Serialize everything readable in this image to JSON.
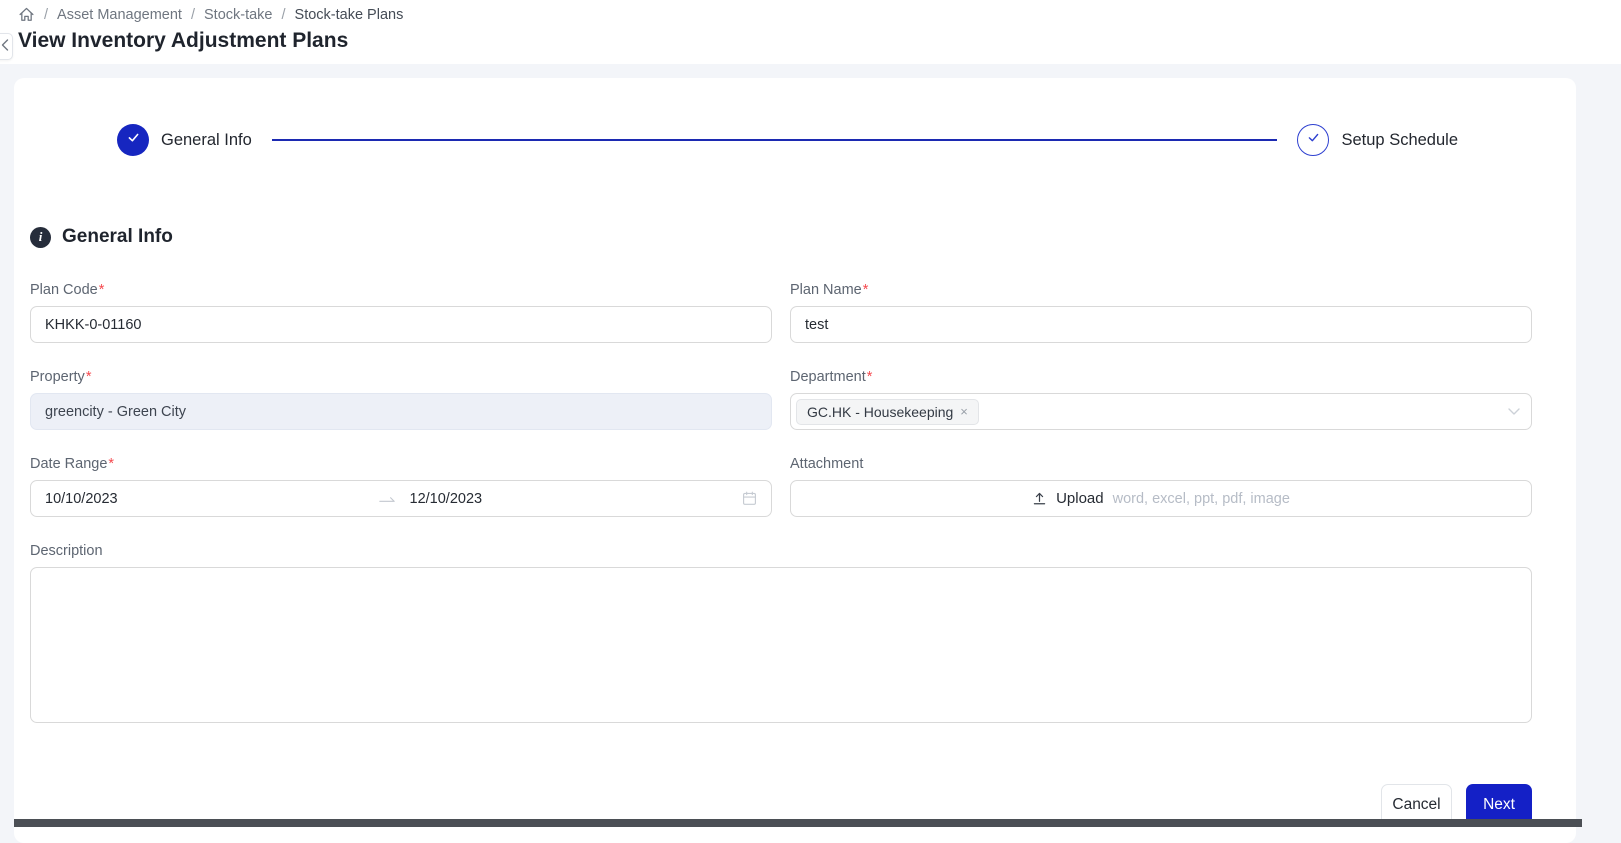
{
  "breadcrumb": {
    "separator": "/",
    "items": [
      "Asset Management",
      "Stock-take",
      "Stock-take Plans"
    ]
  },
  "page_title": "View Inventory Adjustment Plans",
  "stepper": {
    "steps": [
      {
        "label": "General Info"
      },
      {
        "label": "Setup Schedule"
      }
    ]
  },
  "section_header": {
    "icon_glyph": "i",
    "title": "General Info"
  },
  "form": {
    "required_mark": "*",
    "plan_code": {
      "label": "Plan Code",
      "value": "KHKK-0-01160"
    },
    "plan_name": {
      "label": "Plan Name",
      "value": "test"
    },
    "property": {
      "label": "Property",
      "value": "greencity - Green City"
    },
    "department": {
      "label": "Department",
      "tag_label": "GC.HK - Housekeeping",
      "tag_remove": "×"
    },
    "date_range": {
      "label": "Date Range",
      "start": "10/10/2023",
      "end": "12/10/2023"
    },
    "attachment": {
      "label": "Attachment",
      "upload_label": "Upload",
      "upload_hint": "word, excel, ppt, pdf, image"
    },
    "description": {
      "label": "Description",
      "value": ""
    }
  },
  "footer": {
    "cancel": "Cancel",
    "next": "Next"
  },
  "colors": {
    "primary": "#1420c6",
    "step_blue": "#1626c0",
    "required": "#f5494e",
    "page_bg": "#f3f5f9",
    "disabled_bg": "#edf0f7",
    "bottom_bar": "#4b4f55"
  }
}
